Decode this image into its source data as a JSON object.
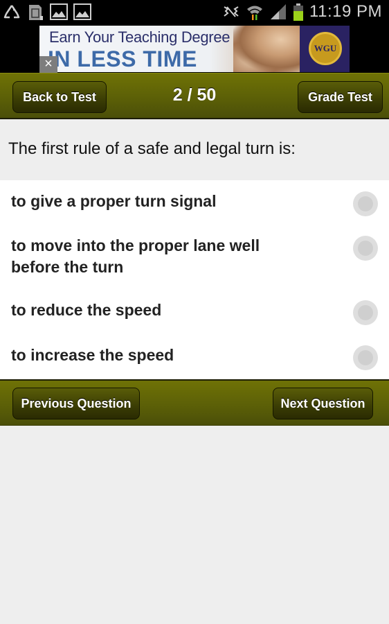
{
  "status_bar": {
    "icons_left": [
      "recycle-icon",
      "sd-card-icon",
      "image-icon",
      "image-icon"
    ],
    "icons_right": [
      "mute-icon",
      "wifi-icon",
      "signal-icon",
      "battery-icon"
    ],
    "time": "11:19 PM",
    "battery_level_percent": 60
  },
  "ad": {
    "line1": "Earn Your Teaching Degree",
    "line2": "IN LESS TIME",
    "logo_text": "WGU",
    "close_label": "×"
  },
  "header": {
    "back_label": "Back to Test",
    "progress_text": "2 / 50",
    "grade_label": "Grade Test"
  },
  "question": {
    "text": "The first rule of a safe and legal turn is:"
  },
  "options": [
    {
      "text": "to give a proper turn signal",
      "selected": false
    },
    {
      "text": "to move into the proper lane well before the turn",
      "selected": false
    },
    {
      "text": "to reduce the speed",
      "selected": false
    },
    {
      "text": "to increase the speed",
      "selected": false
    }
  ],
  "footer": {
    "previous_label": "Previous Question",
    "next_label": "Next Question"
  },
  "colors": {
    "bar_olive": "#5c6007",
    "button_dark": "#3a3c04",
    "background": "#eeeeee"
  }
}
